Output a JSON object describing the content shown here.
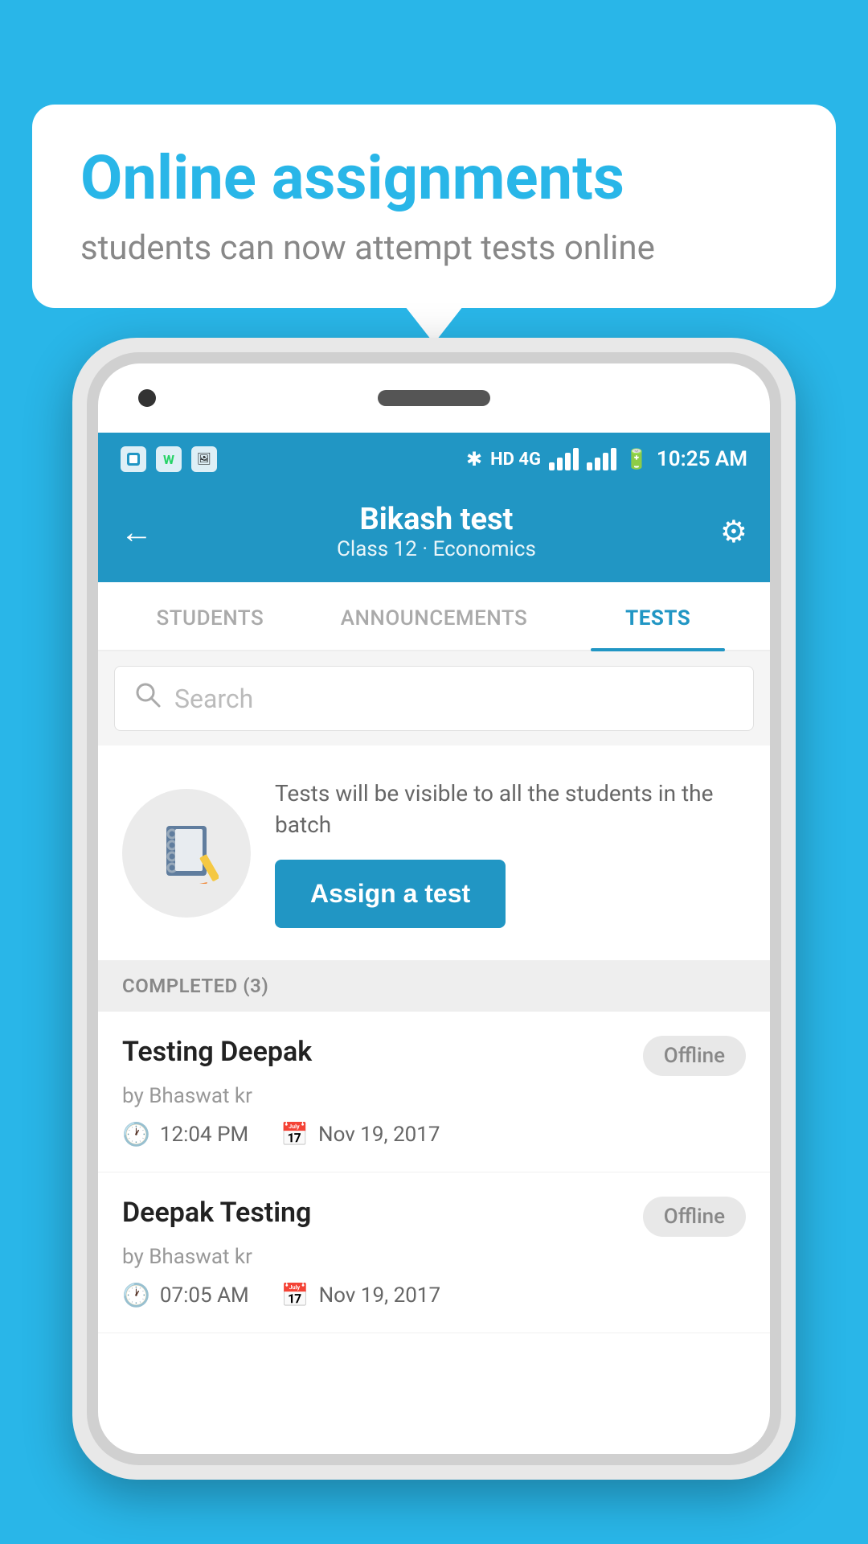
{
  "background_color": "#29b6e8",
  "bubble": {
    "title": "Online assignments",
    "subtitle": "students can now attempt tests online"
  },
  "status_bar": {
    "time": "10:25 AM",
    "network": "HD 4G"
  },
  "header": {
    "title": "Bikash test",
    "subtitle": "Class 12 · Economics",
    "back_label": "←",
    "gear_label": "⚙"
  },
  "tabs": [
    {
      "label": "STUDENTS",
      "active": false
    },
    {
      "label": "ANNOUNCEMENTS",
      "active": false
    },
    {
      "label": "TESTS",
      "active": true
    }
  ],
  "search": {
    "placeholder": "Search"
  },
  "info": {
    "description": "Tests will be visible to all the students in the batch",
    "assign_button": "Assign a test"
  },
  "completed_section": {
    "header": "COMPLETED (3)"
  },
  "tests": [
    {
      "name": "Testing Deepak",
      "author": "by Bhaswat kr",
      "time": "12:04 PM",
      "date": "Nov 19, 2017",
      "status": "Offline"
    },
    {
      "name": "Deepak Testing",
      "author": "by Bhaswat kr",
      "time": "07:05 AM",
      "date": "Nov 19, 2017",
      "status": "Offline"
    }
  ]
}
